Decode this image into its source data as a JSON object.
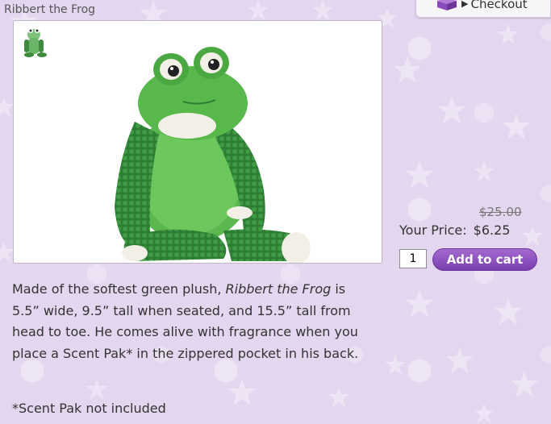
{
  "product": {
    "title": "Ribbert the Frog",
    "old_price": "$25.00",
    "price_label": "Your Price:",
    "price": "$6.25",
    "quantity": "1"
  },
  "header": {
    "checkout_label": "Checkout"
  },
  "actions": {
    "add_to_cart_label": "Add to cart"
  },
  "description": {
    "part1": "Made of the softest green plush, ",
    "italic_name": "Ribbert the Frog",
    "part2": " is 5.5” wide, 9.5” tall when seated, and 15.5” tall from head to toe. He comes alive with fragrance when you place a Scent Pak* in the zippered pocket in his back.",
    "note": "*Scent Pak not included"
  },
  "colors": {
    "background": "#e4d6ee",
    "accent_button": "#8a4fbf",
    "frog_green": "#3f9a3c"
  },
  "icons": {
    "checkout": "gift-box-icon",
    "checkout_arrow": "triangle-right-icon"
  }
}
